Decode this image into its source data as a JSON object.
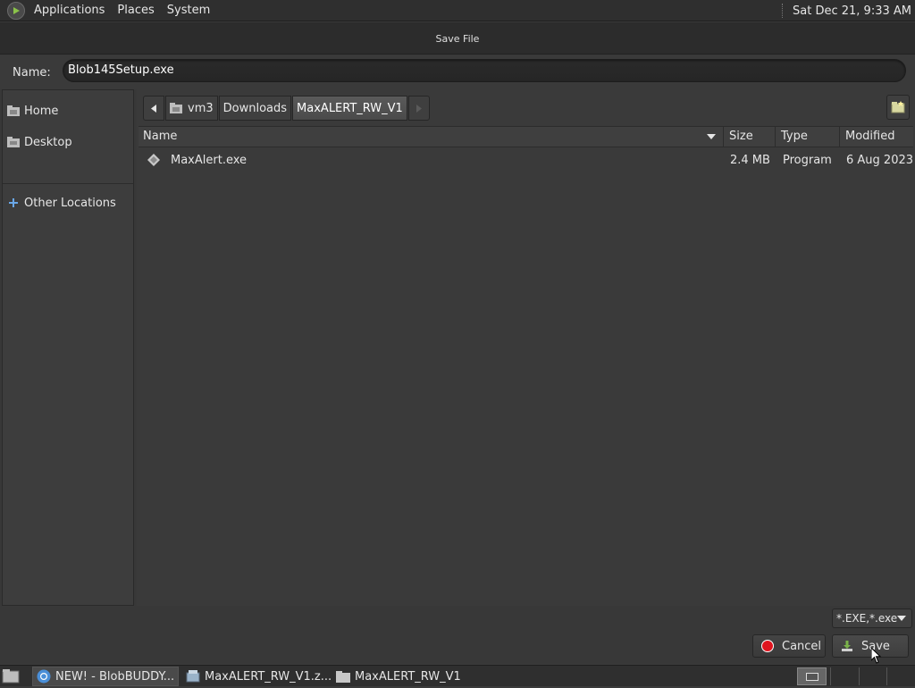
{
  "top_panel": {
    "menus": [
      "Applications",
      "Places",
      "System"
    ],
    "clock": "Sat Dec 21,  9:33 AM"
  },
  "dialog": {
    "title": "Save File",
    "name_label": "Name:",
    "filename": "Blob145Setup.exe"
  },
  "sidebar": {
    "items": [
      {
        "label": "Home",
        "icon": "home-folder-icon"
      },
      {
        "label": "Desktop",
        "icon": "desktop-folder-icon"
      },
      {
        "label": "Other Locations",
        "icon": "plus-icon"
      }
    ]
  },
  "pathbar": {
    "segments": [
      "vm3",
      "Downloads",
      "MaxALERT_RW_V1"
    ],
    "active_index": 2
  },
  "filelist": {
    "columns": [
      "Name",
      "Size",
      "Type",
      "Modified"
    ],
    "rows": [
      {
        "name": "MaxAlert.exe",
        "size": "2.4 MB",
        "type": "Program",
        "modified": "6 Aug 2023"
      }
    ]
  },
  "filter": {
    "value": "*.EXE,*.exe"
  },
  "buttons": {
    "cancel": "Cancel",
    "save": "Save"
  },
  "taskbar": {
    "tasks": [
      {
        "label": "NEW! - BlobBUDDY...",
        "icon": "chrome-icon",
        "active": true
      },
      {
        "label": "MaxALERT_RW_V1.z...",
        "icon": "archive-icon",
        "active": false
      },
      {
        "label": "MaxALERT_RW_V1",
        "icon": "folder-icon",
        "active": false
      }
    ]
  },
  "colors": {
    "background": "#3b3b3b",
    "panel": "#2f2f2f",
    "text": "#e6e6e6",
    "cancel_red": "#e0141e",
    "save_green": "#7ab24a"
  }
}
